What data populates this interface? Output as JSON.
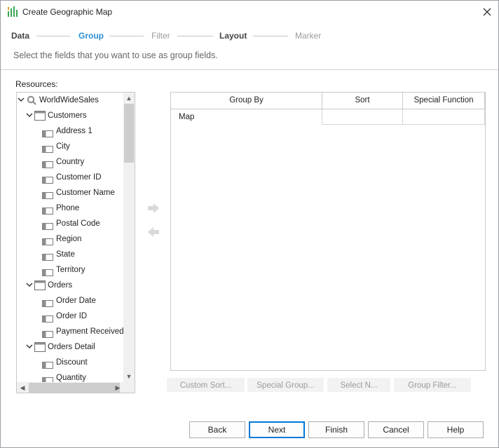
{
  "window": {
    "title": "Create Geographic Map",
    "close_icon": "close-icon",
    "app_icon": "chart-bars-icon"
  },
  "steps": [
    {
      "label": "Data",
      "state": "done"
    },
    {
      "label": "Group",
      "state": "active"
    },
    {
      "label": "Filter",
      "state": "todo"
    },
    {
      "label": "Layout",
      "state": "done"
    },
    {
      "label": "Marker",
      "state": "todo"
    }
  ],
  "colors": {
    "active_step": "#2b8fd6",
    "default_button_border": "#0078d7",
    "disabled_text": "#9a9a9a"
  },
  "subtitle": "Select the fields that you want to use as group fields.",
  "resources": {
    "label": "Resources:",
    "tree": [
      {
        "label": "WorldWideSales",
        "kind": "query",
        "icon": "query-icon",
        "expanded": true
      },
      {
        "label": "Customers",
        "kind": "table",
        "icon": "table-icon",
        "expanded": true
      },
      {
        "label": "Address 1",
        "kind": "field",
        "icon": "field-icon"
      },
      {
        "label": "City",
        "kind": "field",
        "icon": "field-icon"
      },
      {
        "label": "Country",
        "kind": "field",
        "icon": "field-icon"
      },
      {
        "label": "Customer ID",
        "kind": "field",
        "icon": "field-icon"
      },
      {
        "label": "Customer Name",
        "kind": "field",
        "icon": "field-icon"
      },
      {
        "label": "Phone",
        "kind": "field",
        "icon": "field-icon"
      },
      {
        "label": "Postal Code",
        "kind": "field",
        "icon": "field-icon"
      },
      {
        "label": "Region",
        "kind": "field",
        "icon": "field-icon"
      },
      {
        "label": "State",
        "kind": "field",
        "icon": "field-icon"
      },
      {
        "label": "Territory",
        "kind": "field",
        "icon": "field-icon"
      },
      {
        "label": "Orders",
        "kind": "table",
        "icon": "table-icon",
        "expanded": true
      },
      {
        "label": "Order Date",
        "kind": "field",
        "icon": "field-icon"
      },
      {
        "label": "Order ID",
        "kind": "field",
        "icon": "field-icon"
      },
      {
        "label": "Payment Received",
        "kind": "field",
        "icon": "field-icon"
      },
      {
        "label": "Orders Detail",
        "kind": "table",
        "icon": "table-icon",
        "expanded": true
      },
      {
        "label": "Discount",
        "kind": "field",
        "icon": "field-icon"
      },
      {
        "label": "Quantity",
        "kind": "field",
        "icon": "field-icon"
      }
    ]
  },
  "move_buttons": {
    "add_icon": "arrow-right-icon",
    "remove_icon": "arrow-left-icon"
  },
  "group_table": {
    "columns": [
      "Group By",
      "Sort",
      "Special Function"
    ],
    "rows": [
      [
        "Map",
        "",
        ""
      ]
    ]
  },
  "group_actions": [
    "Custom Sort...",
    "Special Group...",
    "Select N...",
    "Group Filter..."
  ],
  "footer": {
    "back": "Back",
    "next": "Next",
    "finish": "Finish",
    "cancel": "Cancel",
    "help": "Help"
  }
}
